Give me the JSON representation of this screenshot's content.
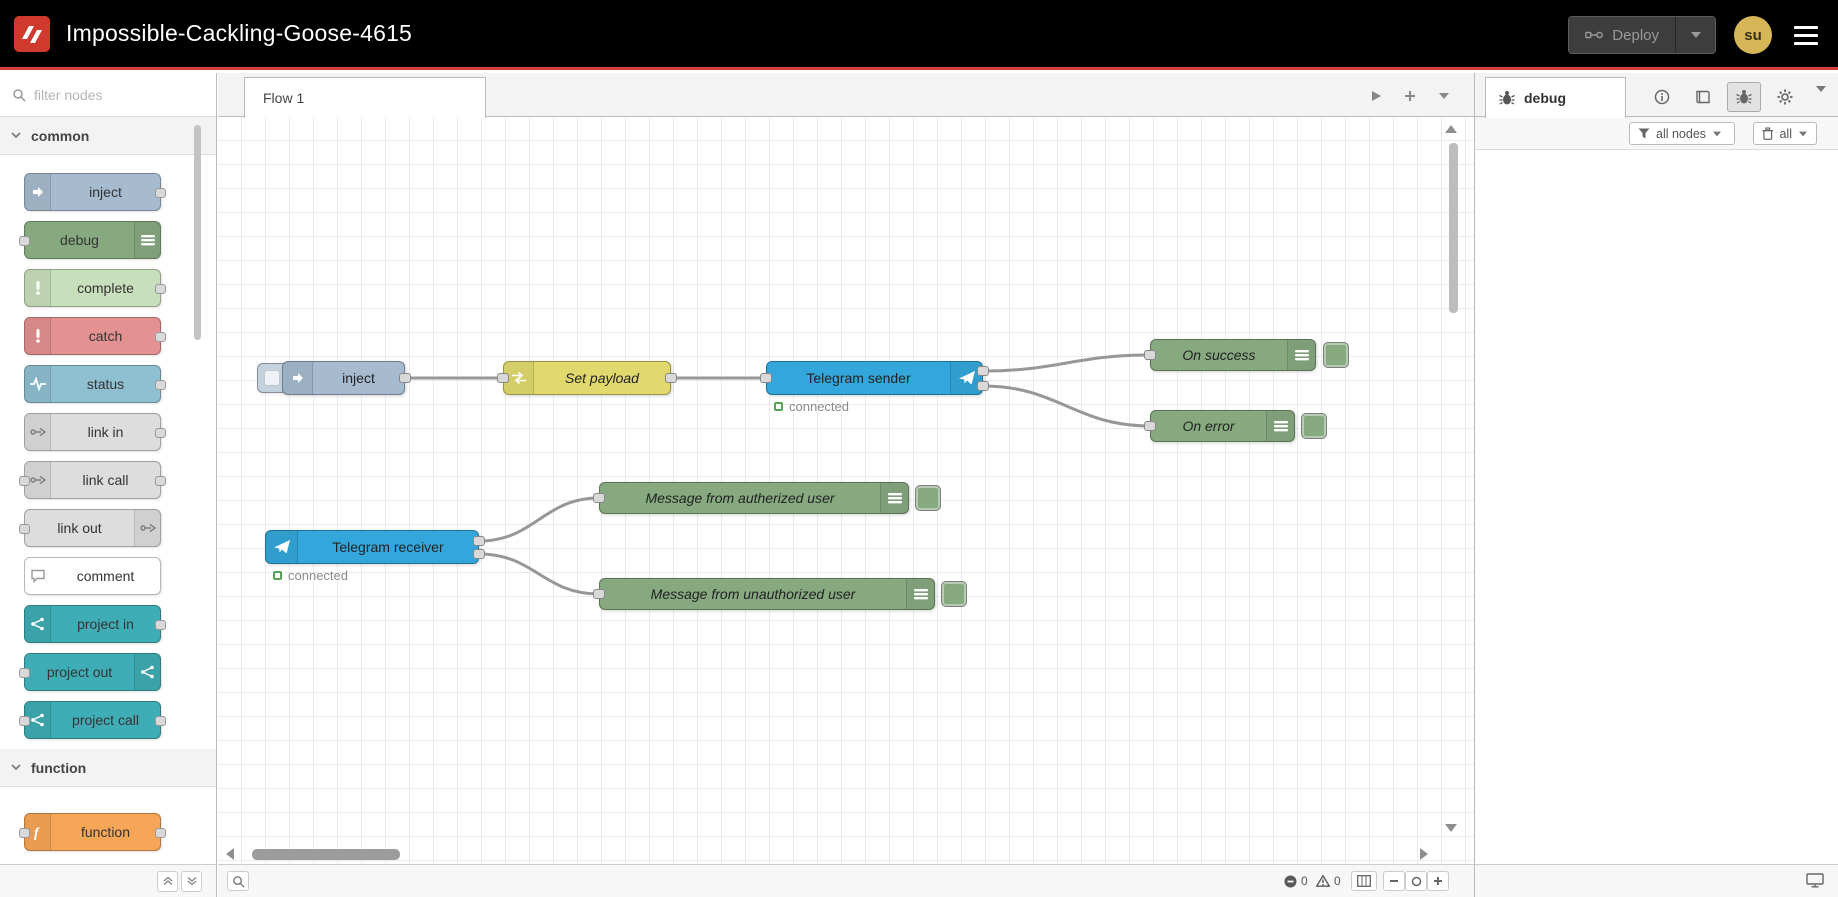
{
  "header": {
    "title": "Impossible-Cackling-Goose-4615",
    "deploy_label": "Deploy",
    "avatar_initials": "su"
  },
  "colors": {
    "header_bg": "#000000",
    "header_underline": "#d63d3d",
    "telegram_blue": "#33a7dc",
    "debug_green": "#87a980",
    "change_yellow": "#e2d96e"
  },
  "palette": {
    "search_placeholder": "filter nodes",
    "categories": [
      {
        "label": "common",
        "items": [
          {
            "label": "inject",
            "color": "#a6bbcf",
            "icon": "inject-icon"
          },
          {
            "label": "debug",
            "color": "#87a980",
            "icon": "list-icon"
          },
          {
            "label": "complete",
            "color": "#c8dfbb",
            "icon": "exclamation-icon"
          },
          {
            "label": "catch",
            "color": "#e49191",
            "icon": "exclamation-icon"
          },
          {
            "label": "status",
            "color": "#8fc0d1",
            "icon": "status-wave-icon"
          },
          {
            "label": "link in",
            "color": "#dddddd",
            "icon": "link-icon"
          },
          {
            "label": "link call",
            "color": "#dddddd",
            "icon": "link-icon"
          },
          {
            "label": "link out",
            "color": "#dddddd",
            "icon": "link-icon"
          },
          {
            "label": "comment",
            "color": "#ffffff",
            "icon": "comment-icon"
          },
          {
            "label": "project in",
            "color": "#3fadb5",
            "icon": "project-icon"
          },
          {
            "label": "project out",
            "color": "#3fadb5",
            "icon": "project-icon"
          },
          {
            "label": "project call",
            "color": "#3fadb5",
            "icon": "project-icon"
          }
        ]
      },
      {
        "label": "function",
        "items": [
          {
            "label": "function",
            "color": "#f7a557",
            "icon": "function-icon"
          }
        ]
      }
    ]
  },
  "workspace": {
    "tabs": [
      {
        "label": "Flow 1"
      }
    ],
    "nodes": [
      {
        "label": "inject",
        "color": "#a6bbcf"
      },
      {
        "label": "Set payload",
        "color": "#e2d96e"
      },
      {
        "label": "Telegram sender",
        "color": "#33a7dc",
        "status": "connected"
      },
      {
        "label": "On success",
        "color": "#87a980"
      },
      {
        "label": "On error",
        "color": "#87a980"
      },
      {
        "label": "Telegram receiver",
        "color": "#33a7dc",
        "status": "connected"
      },
      {
        "label": "Message from autherized user",
        "color": "#87a980"
      },
      {
        "label": "Message from unauthorized user",
        "color": "#87a980"
      }
    ],
    "footer": {
      "error_count": "0",
      "warning_count": "0"
    }
  },
  "sidebar": {
    "active_tab_label": "debug",
    "filter_button": "all nodes",
    "clear_button": "all"
  }
}
